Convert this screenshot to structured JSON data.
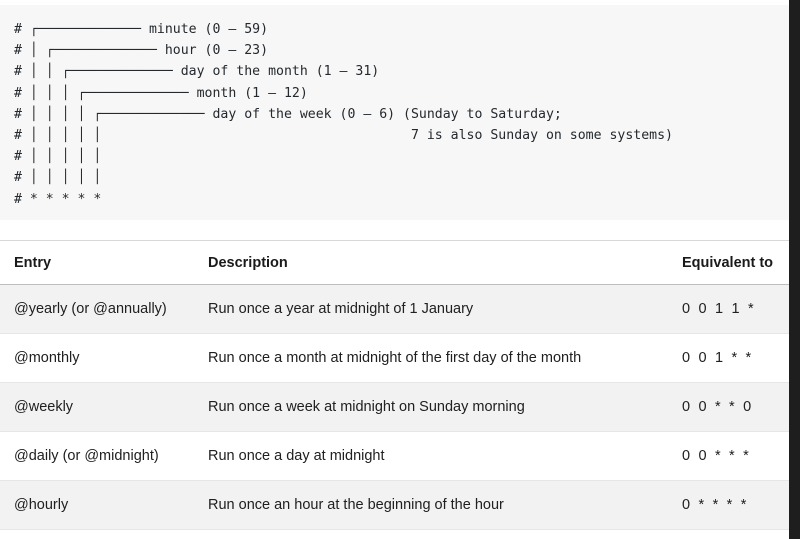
{
  "code_block": {
    "language": "crontab",
    "lines": [
      "# ┌───────────── minute (0 – 59)",
      "# │ ┌───────────── hour (0 – 23)",
      "# │ │ ┌───────────── day of the month (1 – 31)",
      "# │ │ │ ┌───────────── month (1 – 12)",
      "# │ │ │ │ ┌───────────── day of the week (0 – 6) (Sunday to Saturday;",
      "# │ │ │ │ │                                       7 is also Sunday on some systems)",
      "# │ │ │ │ │",
      "# │ │ │ │ │",
      "# * * * * *"
    ],
    "text": "# ┌───────────── minute (0 – 59)\n# │ ┌───────────── hour (0 – 23)\n# │ │ ┌───────────── day of the month (1 – 31)\n# │ │ │ ┌───────────── month (1 – 12)\n# │ │ │ │ ┌───────────── day of the week (0 – 6) (Sunday to Saturday;\n# │ │ │ │ │                                       7 is also Sunday on some systems)\n# │ │ │ │ │\n# │ │ │ │ │\n# * * * * *"
  },
  "table": {
    "headers": {
      "entry": "Entry",
      "description": "Description",
      "equivalent": "Equivalent to"
    },
    "rows": [
      {
        "entry": "@yearly (or @annually)",
        "description": "Run once a year at midnight of 1 January",
        "equivalent": "0 0 1 1 *"
      },
      {
        "entry": "@monthly",
        "description": "Run once a month at midnight of the first day of the month",
        "equivalent": "0 0 1 * *"
      },
      {
        "entry": "@weekly",
        "description": "Run once a week at midnight on Sunday morning",
        "equivalent": "0 0 * * 0"
      },
      {
        "entry": "@daily (or @midnight)",
        "description": "Run once a day at midnight",
        "equivalent": "0 0 * * *"
      },
      {
        "entry": "@hourly",
        "description": "Run once an hour at the beginning of the hour",
        "equivalent": "0 * * * *"
      }
    ]
  },
  "colors": {
    "code_background": "#f7f7f7",
    "code_text": "#24292e",
    "row_alt_background": "#f2f2f2",
    "page_background": "#ffffff",
    "scroll_strip": "#1e1e1e",
    "header_rule": "#bdbdbd"
  }
}
